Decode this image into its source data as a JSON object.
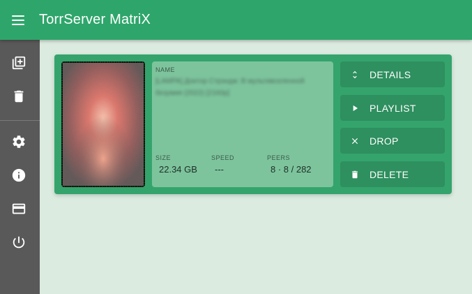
{
  "app": {
    "title": "TorrServer MatriX",
    "accent_color": "#2ea66b",
    "sidebar_color": "#595959",
    "background_color": "#dbebdf"
  },
  "sidebar": {
    "items": [
      {
        "icon": "add-to-library-icon"
      },
      {
        "icon": "trash-icon"
      },
      {
        "icon": "settings-gear-icon"
      },
      {
        "icon": "info-icon"
      },
      {
        "icon": "credit-card-icon"
      },
      {
        "icon": "power-icon"
      }
    ]
  },
  "torrent": {
    "name_label": "NAME",
    "name": "[LAMPA] Доктор Стрэндж: В мультивселенной безумия (2022) [2160p]",
    "size_label": "SIZE",
    "size": "22.34 GB",
    "speed_label": "SPEED",
    "speed": "---",
    "peers_label": "PEERS",
    "peers": "8 · 8 / 282"
  },
  "actions": {
    "details": "DETAILS",
    "playlist": "PLAYLIST",
    "drop": "DROP",
    "delete": "DELETE"
  }
}
